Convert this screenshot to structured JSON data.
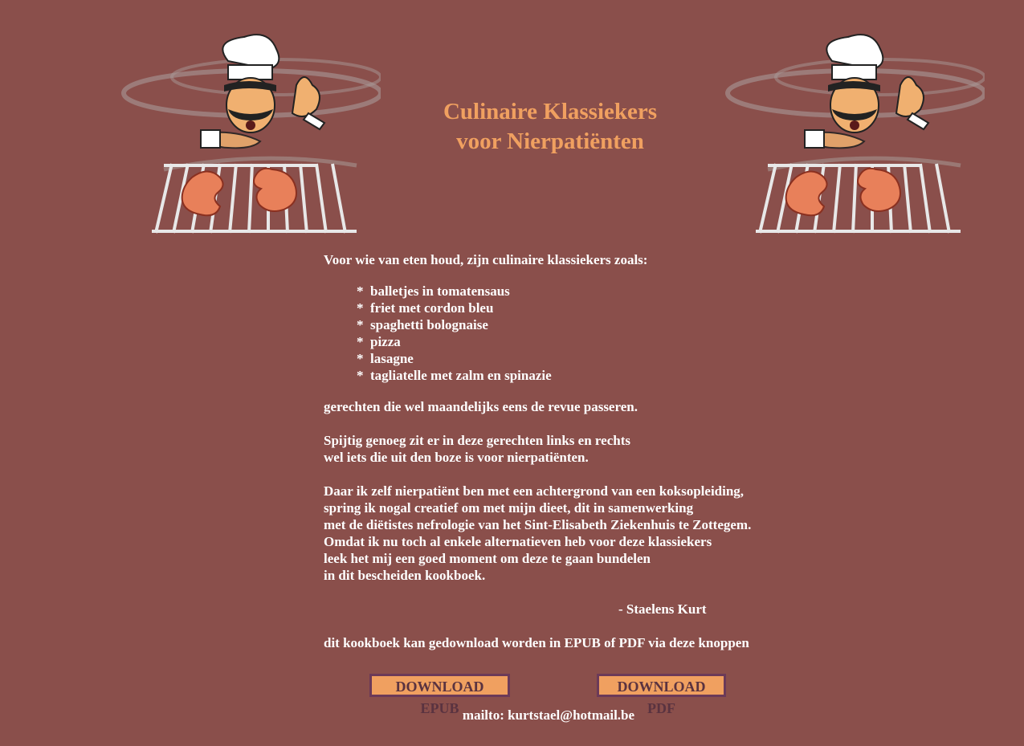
{
  "header": {
    "title_line1": "Culinaire Klassiekers",
    "title_line2": "voor Nierpatiënten"
  },
  "intro": "Voor wie van eten houd, zijn culinaire klassiekers zoals:",
  "dishes": [
    "balletjes in tomatensaus",
    "friet met cordon bleu",
    "spaghetti bolognaise",
    "pizza",
    "lasagne",
    "tagliatelle met zalm en spinazie"
  ],
  "bullet": "*",
  "after_list": "gerechten die wel maandelijks eens de revue passeren.",
  "paragraph2": [
    "Spijtig genoeg zit er in deze gerechten links en rechts",
    "wel iets die uit den boze is voor nierpatiënten."
  ],
  "paragraph3": [
    "Daar ik zelf nierpatiënt ben met een achtergrond van een koksopleiding,",
    "spring ik nogal creatief om met mijn dieet, dit in samenwerking",
    "met de diëtistes nefrologie van het Sint-Elisabeth Ziekenhuis te Zottegem.",
    "Omdat ik nu toch al enkele alternatieven heb voor deze klassiekers",
    "leek het mij een goed moment om deze te gaan bundelen",
    "in dit bescheiden kookboek."
  ],
  "signature": "- Staelens Kurt",
  "download_text": "dit kookboek kan gedownload worden in EPUB of PDF via deze knoppen",
  "buttons": {
    "epub": "DOWNLOAD EPUB",
    "pdf": "DOWNLOAD PDF"
  },
  "mail": "mailto: kurtstael@hotmail.be",
  "colors": {
    "background": "#8a4f4b",
    "title": "#f0a060",
    "button_bg": "#f0a060",
    "button_border": "#6b3a58"
  },
  "illustration": "chef-grilling-kidneys-icon"
}
